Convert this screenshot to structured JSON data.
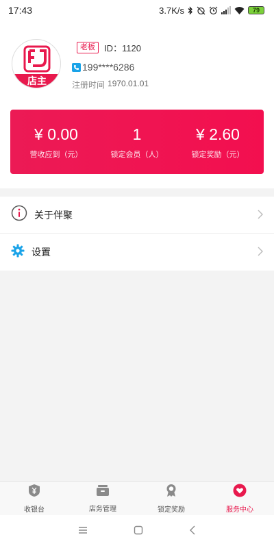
{
  "status_bar": {
    "time": "17:43",
    "network_speed": "3.7K/s",
    "battery": "79",
    "icons": [
      "bluetooth-icon",
      "alarm-off-icon",
      "alarm-icon",
      "signal-icon",
      "wifi-icon",
      "battery-icon"
    ]
  },
  "profile": {
    "avatar_text": "店主",
    "role_badge": "老板",
    "user_id": "ID：1120",
    "phone": "199****6286",
    "register_label": "注册时间",
    "register_date": "1970.01.01"
  },
  "stats": [
    {
      "value": "¥ 0.00",
      "label": "营收应到（元）"
    },
    {
      "value": "1",
      "label": "锁定会员（人）"
    },
    {
      "value": "¥ 2.60",
      "label": "锁定奖励（元）"
    }
  ],
  "menu": [
    {
      "label": "关于伴聚",
      "icon": "info-icon"
    },
    {
      "label": "设置",
      "icon": "gear-icon"
    }
  ],
  "tabs": [
    {
      "label": "收银台",
      "icon": "cashier-icon",
      "active": false
    },
    {
      "label": "店务管理",
      "icon": "store-icon",
      "active": false
    },
    {
      "label": "锁定奖励",
      "icon": "award-icon",
      "active": false
    },
    {
      "label": "服务中心",
      "icon": "heart-icon",
      "active": true
    }
  ],
  "colors": {
    "accent": "#e8194d",
    "card_gradient": [
      "#ec1a55",
      "#f30f4f"
    ],
    "phone_icon": "#1aa3e8",
    "gear_icon": "#1aa3e8"
  }
}
